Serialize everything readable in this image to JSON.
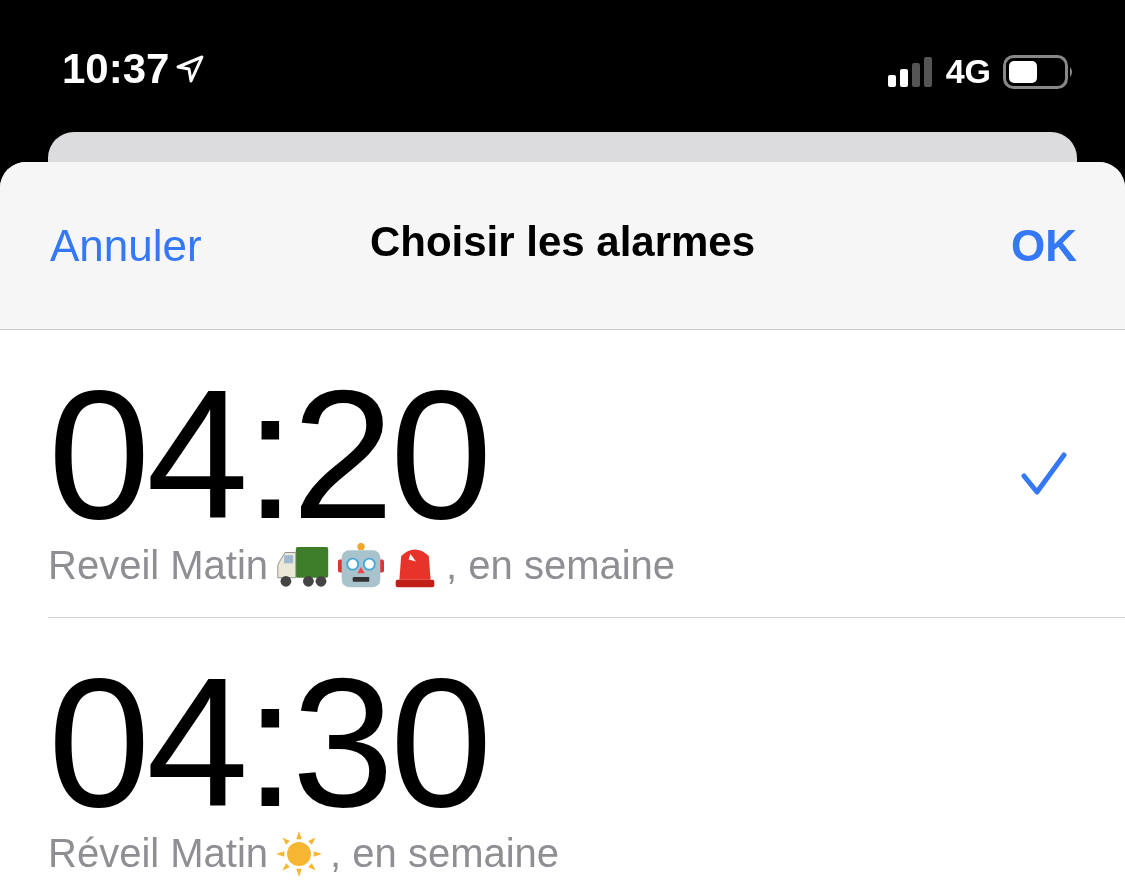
{
  "status_bar": {
    "time": "10:37",
    "network": "4G"
  },
  "sheet": {
    "cancel": "Annuler",
    "title": "Choisir les alarmes",
    "confirm": "OK"
  },
  "alarms": [
    {
      "time": "04:20",
      "name": "Reveil Matin",
      "badges": [
        {
          "kind": "truck"
        },
        {
          "kind": "robot"
        },
        {
          "kind": "siren"
        }
      ],
      "repeat": ", en semaine",
      "selected": true
    },
    {
      "time": "04:30",
      "name": "Réveil Matin",
      "badges": [
        {
          "kind": "sun"
        }
      ],
      "repeat": ", en semaine",
      "selected": false
    }
  ]
}
